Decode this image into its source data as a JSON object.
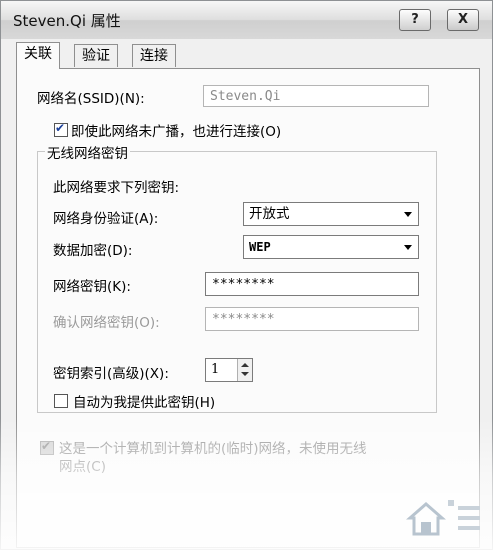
{
  "window": {
    "title": "Steven.Qi 属性",
    "help_label": "?",
    "close_label": "X"
  },
  "tabs": [
    {
      "label": "关联"
    },
    {
      "label": "验证"
    },
    {
      "label": "连接"
    }
  ],
  "ssid": {
    "label": "网络名(SSID)(N):",
    "value": "Steven.Qi"
  },
  "broadcast": {
    "label": "即使此网络未广播，也进行连接(O)",
    "checked": true
  },
  "wireless_key": {
    "group_title": "无线网络密钥",
    "description": "此网络要求下列密钥:",
    "auth_label": "网络身份验证(A):",
    "auth_value": "开放式",
    "encryption_label": "数据加密(D):",
    "encryption_value": "WEP",
    "key_label": "网络密钥(K):",
    "key_value": "********",
    "confirm_label": "确认网络密钥(O):",
    "confirm_value": "********",
    "index_label": "密钥索引(高级)(X):",
    "index_value": "1",
    "auto_label": "自动为我提供此密钥(H)",
    "auto_checked": false
  },
  "adhoc": {
    "line1": "这是一个计算机到计算机的(临时)网络，未使用无线",
    "line2": "网点(C)",
    "checked": true
  },
  "watermark": {
    "icon": "system-house-logo-icon"
  }
}
